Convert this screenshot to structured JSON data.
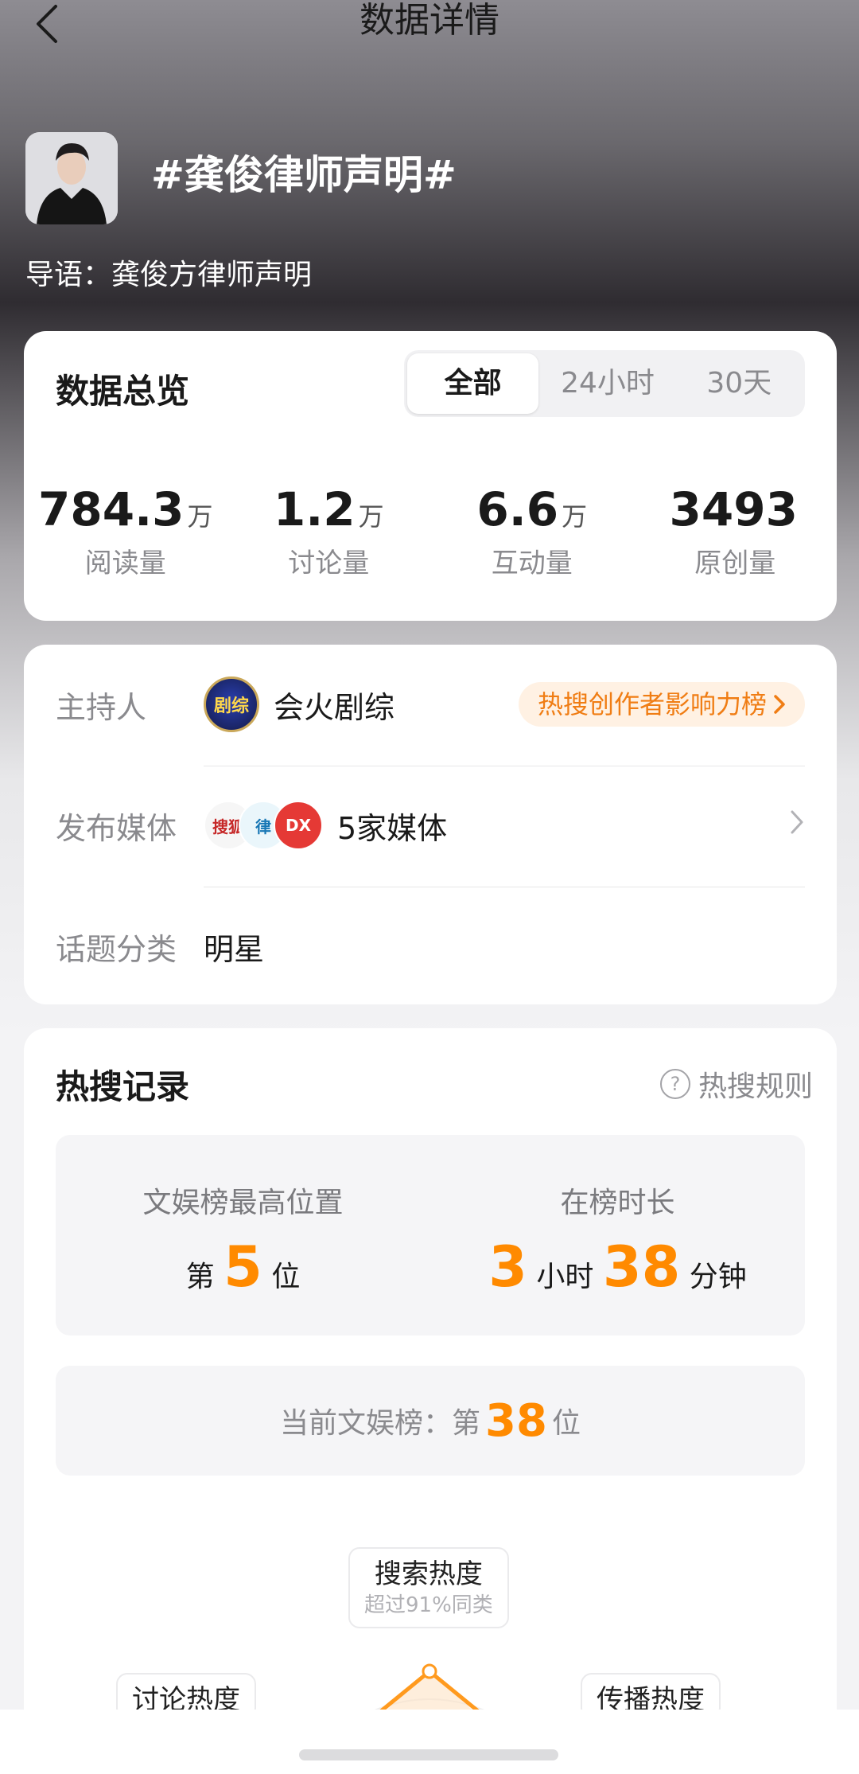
{
  "header": {
    "title": "数据详情"
  },
  "topic": {
    "title": "#龚俊律师声明#",
    "lead_label": "导语：",
    "lead_text": "龚俊方律师声明"
  },
  "overview": {
    "title": "数据总览",
    "tabs": [
      "全部",
      "24小时",
      "30天"
    ],
    "active_tab": "全部",
    "stats": [
      {
        "value": "784.3",
        "unit": "万",
        "label": "阅读量"
      },
      {
        "value": "1.2",
        "unit": "万",
        "label": "讨论量"
      },
      {
        "value": "6.6",
        "unit": "万",
        "label": "互动量"
      },
      {
        "value": "3493",
        "unit": "",
        "label": "原创量"
      }
    ]
  },
  "info": {
    "host_label": "主持人",
    "host_name": "会火剧综",
    "host_logo_text": "剧综",
    "rank_link": "热搜创作者影响力榜",
    "media_label": "发布媒体",
    "media_count": "5家媒体",
    "category_label": "话题分类",
    "category_value": "明星"
  },
  "hot_search": {
    "title": "热搜记录",
    "rule_link": "热搜规则",
    "best_position_label": "文娱榜最高位置",
    "best_position_prefix": "第",
    "best_position_value": "5",
    "best_position_suffix": "位",
    "duration_label": "在榜时长",
    "duration_hours": "3",
    "duration_hours_unit": "小时",
    "duration_minutes": "38",
    "duration_minutes_unit": "分钟",
    "current_label": "当前文娱榜：第",
    "current_value": "38",
    "current_suffix": "位",
    "radar": {
      "search_title": "搜索热度",
      "search_sub": "超过91%同类",
      "discuss_title": "讨论热度",
      "spread_title": "传播热度"
    }
  },
  "colors": {
    "accent_orange": "#ff8a00",
    "pill_bg": "#fff1e3",
    "pill_text": "#f07d14"
  }
}
